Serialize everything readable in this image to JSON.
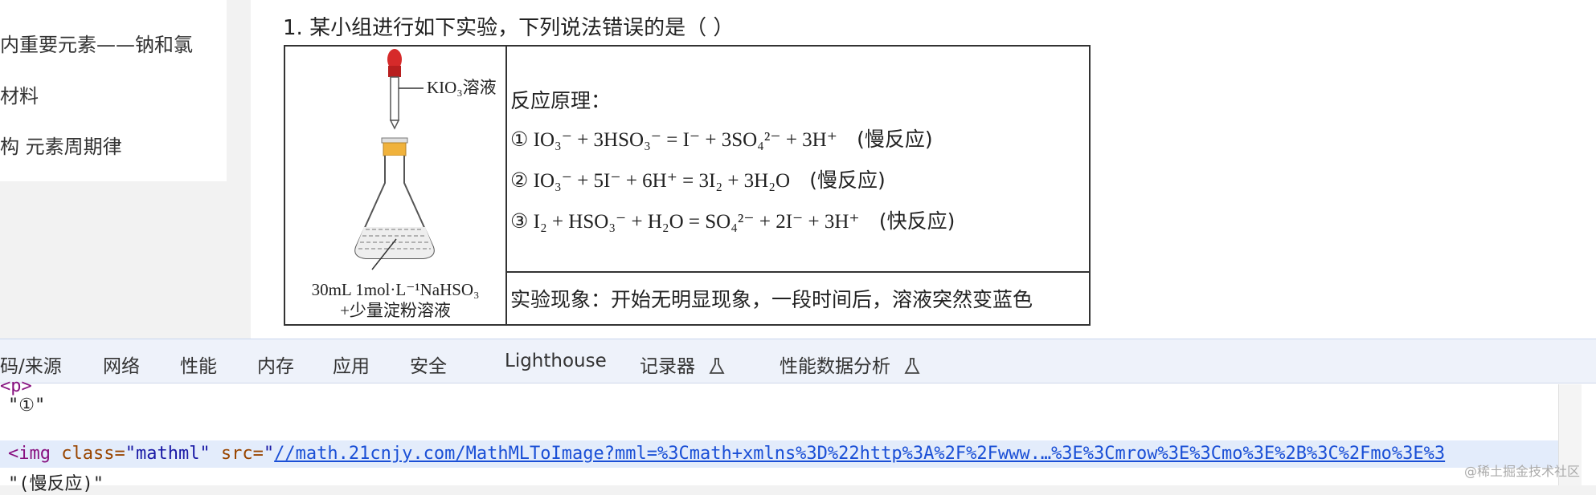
{
  "sidebar": {
    "items": [
      {
        "label": "内重要元素——钠和氯"
      },
      {
        "label": "材料"
      },
      {
        "label": "构 元素周期律"
      }
    ]
  },
  "question": {
    "title": "1. 某小组进行如下实验，下列说法错误的是（  ）",
    "reagent_label": "KIO₃溶液",
    "flask_label_line1": "30mL 1mol·L⁻¹NaHSO₃",
    "flask_label_line2": "+少量淀粉溶液",
    "principle_title": "反应原理：",
    "reactions": [
      {
        "num": "①",
        "eq": "IO₃⁻ + 3HSO₃⁻ = I⁻ + 3SO₄²⁻ + 3H⁺",
        "speed": "(慢反应)"
      },
      {
        "num": "②",
        "eq": "IO₃⁻ + 5I⁻ + 6H⁺ = 3I₂ + 3H₂O",
        "speed": "(慢反应)"
      },
      {
        "num": "③",
        "eq": "I₂ + HSO₃⁻ + H₂O = SO₄²⁻ + 2I⁻ + 3H⁺",
        "speed": "(快反应)"
      }
    ],
    "phenomenon": "实验现象：开始无明显现象，一段时间后，溶液突然变蓝色"
  },
  "devtools": {
    "tabs": [
      {
        "label": "码/来源"
      },
      {
        "label": "网络"
      },
      {
        "label": "性能"
      },
      {
        "label": "内存"
      },
      {
        "label": "应用"
      },
      {
        "label": "安全"
      },
      {
        "label": "Lighthouse"
      },
      {
        "label": "记录器"
      },
      {
        "label": "性能数据分析"
      }
    ],
    "dom": {
      "line0": "<p>",
      "line1": "\"①\"",
      "img_tag_open": "<img ",
      "img_attr_class": "class=",
      "img_class_val": "\"mathml\"",
      "img_attr_src": " src=",
      "img_src_quote": "\"",
      "img_src_url": "//math.21cnjy.com/MathMLToImage?mml=%3Cmath+xmlns%3D%22http%3A%2F%2Fwww.…%3E%3Cmrow%3E%3Cmo%3E%2B%3C%2Fmo%3E%3",
      "line3": "\"(慢反应)\""
    }
  },
  "watermark": "@稀土掘金技术社区",
  "colors": {
    "accent": "#1a4fd6",
    "tag": "#881280",
    "attr": "#994500",
    "dropper": "#d62a2a",
    "cap": "#f0b23c"
  }
}
